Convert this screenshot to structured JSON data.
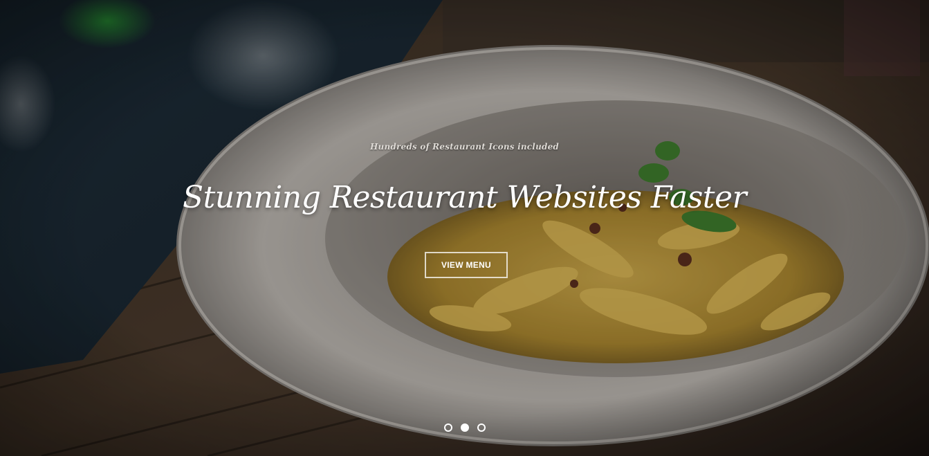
{
  "hero": {
    "subtitle": "Hundreds of Restaurant Icons included",
    "title": "Stunning Restaurant Websites Faster",
    "button_label": "VIEW MENU"
  },
  "carousel": {
    "dot_count": 3,
    "active_index": 1
  },
  "background_image": "pasta-dish-photo"
}
